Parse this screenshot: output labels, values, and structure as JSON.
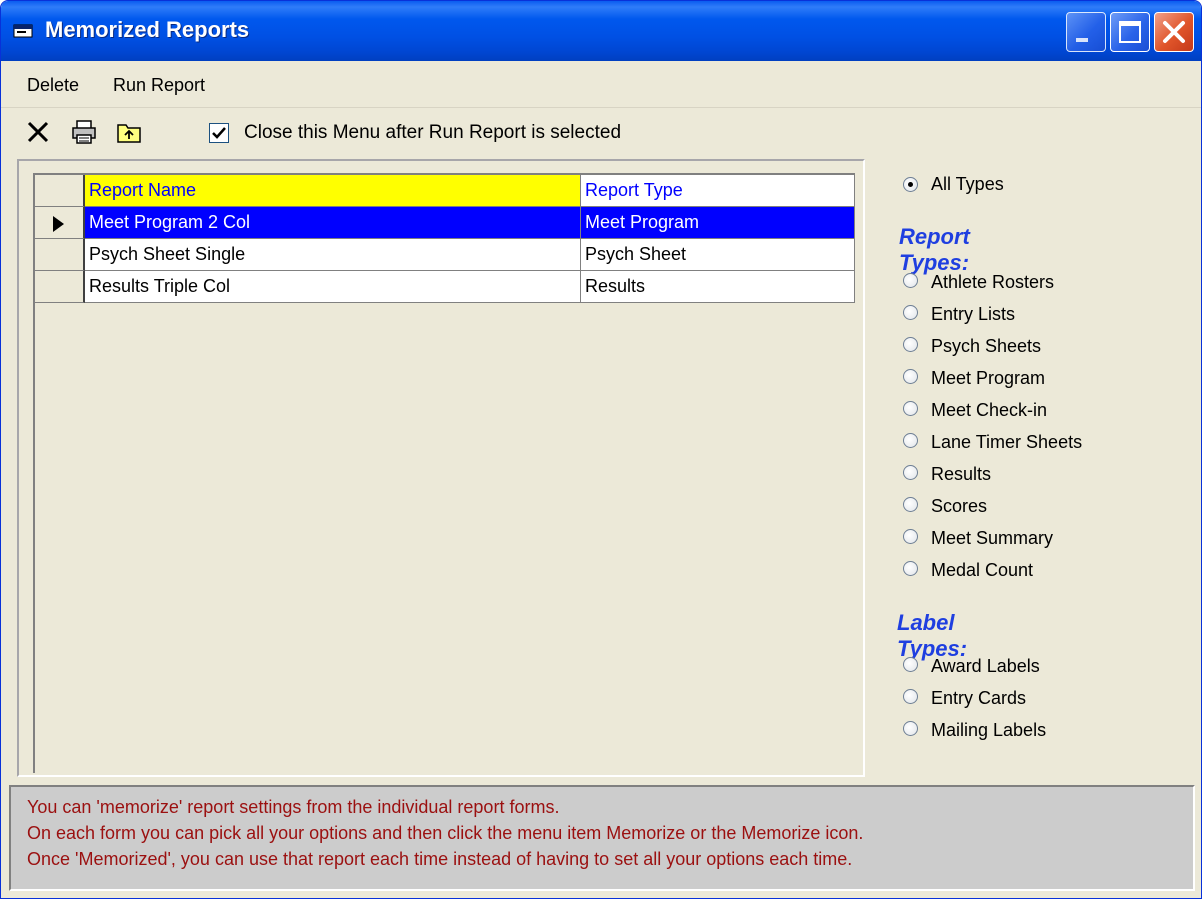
{
  "window": {
    "title": "Memorized Reports"
  },
  "menu": {
    "items": [
      "Delete",
      "Run Report"
    ]
  },
  "toolbar": {
    "icons": [
      "delete-icon",
      "print-icon",
      "folder-up-icon"
    ],
    "close_menu_checked": true,
    "close_menu_label": "Close this Menu after Run Report is selected"
  },
  "grid": {
    "columns": [
      "Report Name",
      "Report Type"
    ],
    "rows": [
      {
        "name": "Meet Program 2 Col",
        "type": "Meet Program",
        "selected": true
      },
      {
        "name": "Psych Sheet Single",
        "type": "Psych Sheet",
        "selected": false
      },
      {
        "name": "Results Triple Col",
        "type": "Results",
        "selected": false
      }
    ]
  },
  "filters": {
    "all_types": "All Types",
    "report_types_heading": "Report Types:",
    "report_types": [
      "Athlete Rosters",
      "Entry Lists",
      "Psych Sheets",
      "Meet Program",
      "Meet Check-in",
      "Lane Timer Sheets",
      "Results",
      "Scores",
      "Meet Summary",
      "Medal Count"
    ],
    "label_types_heading": "Label Types:",
    "label_types": [
      "Award Labels",
      "Entry Cards",
      "Mailing Labels"
    ],
    "selected": "All Types"
  },
  "info": {
    "lines": [
      "You can 'memorize' report settings from the individual report forms.",
      "On each form you can pick all your options and then click the menu item Memorize or the Memorize icon.",
      "Once 'Memorized', you can use that report each time instead of having to set all your options each time."
    ]
  },
  "colors": {
    "title_bar": "#0054e3",
    "header_yellow": "#ffff00",
    "selection_blue": "#0000ff",
    "heading_blue": "#1f3fe0",
    "info_text": "#9b1010"
  }
}
